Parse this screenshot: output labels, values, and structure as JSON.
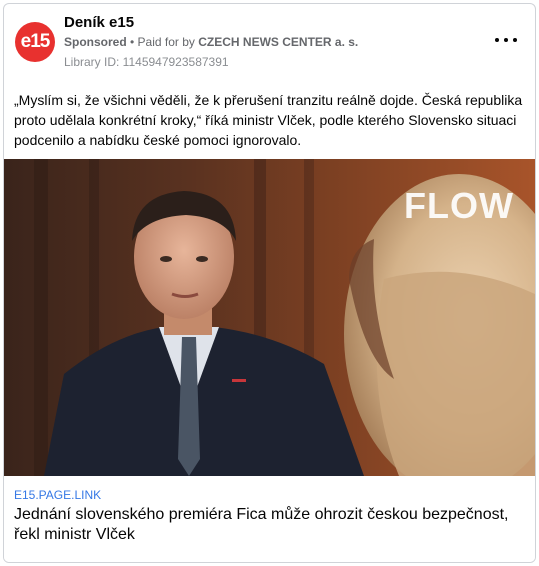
{
  "post": {
    "page_name": "Deník e15",
    "avatar_text": "e15",
    "sponsored_label": "Sponsored",
    "separator": " • ",
    "paid_for_prefix": "Paid for by ",
    "payer": "CZECH NEWS CENTER a. s.",
    "library_id": "Library ID: 1145947923587391",
    "more_icon": "more-horizontal-icon",
    "body_text": "„Myslím si, že všichni věděli, že k přerušení tranzitu reálně dojde. Česká republika proto udělala konkrétní kroky,“ říká ministr Vlček, podle kterého Slovensko situaci podcenilo a nabídku české pomoci ignorovalo."
  },
  "media": {
    "watermark": "FLOW"
  },
  "link": {
    "domain": "E15.PAGE.LINK",
    "title": "Jednání slovenského premiéra Fica může ohrozit českou bezpečnost, řekl ministr Vlček"
  },
  "colors": {
    "brand": "#e8312f",
    "link": "#3578e5",
    "text": "#050505",
    "secondary_text": "#65676b"
  }
}
